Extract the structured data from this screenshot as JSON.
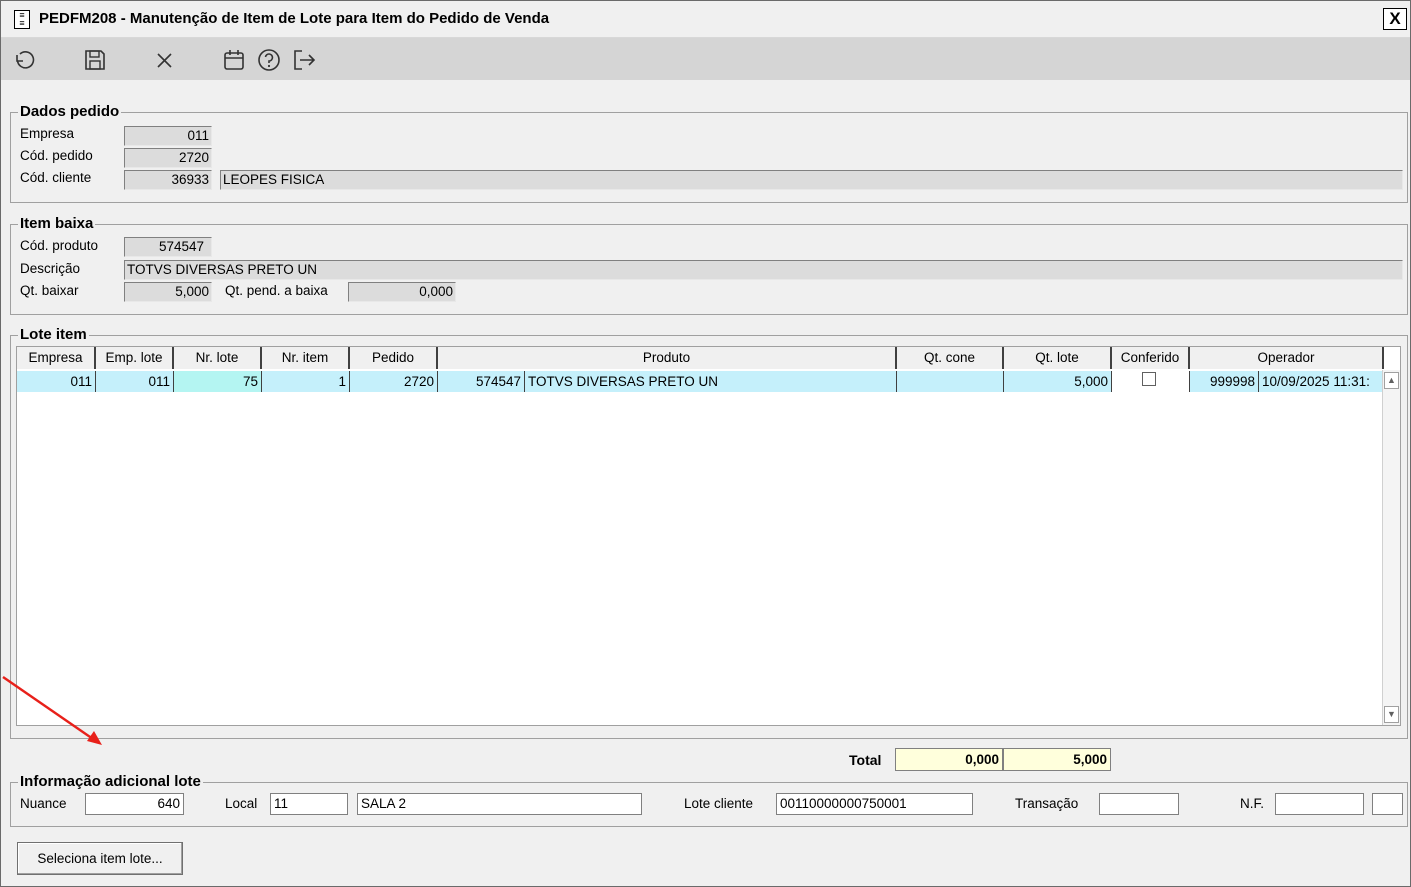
{
  "window": {
    "title": "PEDFM208 - Manutenção de Item de Lote para Item do Pedido de Venda",
    "close_label": "X"
  },
  "toolbar": {
    "icons": [
      "undo-icon",
      "save-icon",
      "cancel-icon",
      "calendar-icon",
      "help-icon",
      "exit-icon"
    ]
  },
  "dados_pedido": {
    "title": "Dados pedido",
    "empresa_label": "Empresa",
    "empresa_value": "011",
    "cod_pedido_label": "Cód. pedido",
    "cod_pedido_value": "2720",
    "cod_cliente_label": "Cód. cliente",
    "cod_cliente_value": "36933",
    "cliente_nome": "LEOPES FISICA"
  },
  "item_baixa": {
    "title": "Item baixa",
    "cod_produto_label": "Cód. produto",
    "cod_produto_value": "574547",
    "descricao_label": "Descrição",
    "descricao_value": "TOTVS DIVERSAS PRETO UN",
    "qt_baixar_label": "Qt. baixar",
    "qt_baixar_value": "5,000",
    "qt_pend_label": "Qt. pend. a baixa",
    "qt_pend_value": "0,000"
  },
  "lote_item": {
    "title": "Lote item",
    "columns": [
      "Empresa",
      "Emp. lote",
      "Nr. lote",
      "Nr. item",
      "Pedido",
      "Produto",
      "Qt. cone",
      "Qt. lote",
      "Conferido",
      "Operador"
    ],
    "row": {
      "empresa": "011",
      "emp_lote": "011",
      "nr_lote": "75",
      "nr_item": "1",
      "pedido": "2720",
      "produto_cod": "574547",
      "produto_desc": "TOTVS DIVERSAS PRETO UN",
      "qt_cone": "",
      "qt_lote": "5,000",
      "conferido": false,
      "operador_cod": "999998",
      "operador_data": "10/09/2025 11:31:"
    }
  },
  "totals": {
    "label": "Total",
    "qt_cone_total": "0,000",
    "qt_lote_total": "5,000"
  },
  "info_adicional": {
    "title": "Informação adicional lote",
    "nuance_label": "Nuance",
    "nuance_value": "640",
    "local_label": "Local",
    "local_code": "11",
    "local_name": "SALA 2",
    "lote_cliente_label": "Lote cliente",
    "lote_cliente_value": "00110000000750001",
    "transacao_label": "Transação",
    "transacao_value": "",
    "nf_label": "N.F.",
    "nf_value": "",
    "nf_serie": ""
  },
  "actions": {
    "seleciona_label": "Seleciona item lote..."
  },
  "annotation": {
    "arrow_color": "#e8201a"
  }
}
